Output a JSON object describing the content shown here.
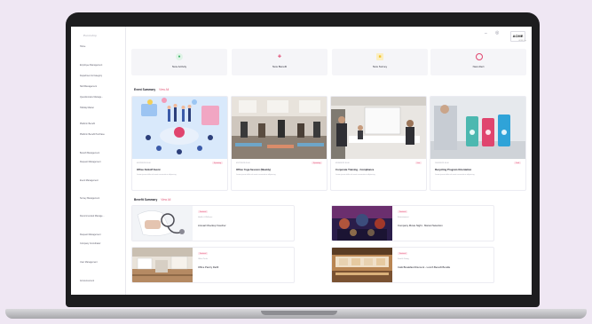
{
  "sidebar": {
    "brand": "Pointship",
    "items": [
      {
        "label": "Home",
        "top": 0
      },
      {
        "label": "Employee Management"
      },
      {
        "label": "Department & Category"
      },
      {
        "label": "Skill Management"
      },
      {
        "label": "Questionnaire Manage..."
      },
      {
        "label": "Holiday Master"
      },
      {
        "label": "Platform Benefit"
      },
      {
        "label": "Platform Benefit Purchase"
      },
      {
        "label": "Benefit Management"
      },
      {
        "label": "Request Management"
      },
      {
        "label": "Event Management"
      },
      {
        "label": "Survey Management"
      },
      {
        "label": "Recommended Manage..."
      },
      {
        "label": "Request Management"
      },
      {
        "label": "Company Coordinator"
      },
      {
        "label": "User Management"
      },
      {
        "label": "Announcement"
      }
    ]
  },
  "header": {
    "logo": "ACME",
    "logo_sub": "ACME Corp",
    "user_icon": "user-icon",
    "minimize_icon": "minus-icon"
  },
  "quick_actions": [
    {
      "label": "New Activity",
      "icon": "leaf-icon",
      "color": "#3fb36a"
    },
    {
      "label": "New Benefit",
      "icon": "gift-icon",
      "color": "#e0456e"
    },
    {
      "label": "New Survey",
      "icon": "star-icon",
      "color": "#f2c230"
    },
    {
      "label": "New Alert",
      "icon": "bell-icon",
      "color": "#e0456e"
    }
  ],
  "event_summary": {
    "title": "Event Summary",
    "link": "View All",
    "events": [
      {
        "date": "09/22/2023 09:00",
        "title": "Office Kickoff Event",
        "desc": "Lorem ipsum dolor sit amet consectetur adipiscing",
        "badge": "Upcoming"
      },
      {
        "date": "09/27/2023 09:00",
        "title": "Office Yoga Session (Weekly)",
        "desc": "Lorem ipsum dolor sit amet consectetur adipiscing",
        "badge": "Upcoming"
      },
      {
        "date": "09/30/2023 10:00",
        "title": "Corporate Training - Compliance",
        "desc": "Lorem ipsum dolor sit amet consectetur adipiscing",
        "badge": "Live"
      },
      {
        "date": "10/05/2023 10:00",
        "title": "Recycling Program Orientation",
        "desc": "Lorem ipsum dolor sit amet consectetur adipiscing",
        "badge": "Draft"
      }
    ]
  },
  "benefit_summary": {
    "title": "Benefit Summary",
    "link": "View All",
    "benefits": [
      {
        "badge": "Featured",
        "category": "Health & Wellness",
        "title": "Annual Checkup Voucher"
      },
      {
        "badge": "Featured",
        "category": "Entertainment",
        "title": "Company Movie Night - Marvel Selection"
      },
      {
        "badge": "Featured",
        "category": "Office Perks",
        "title": "Office Pantry Refill"
      },
      {
        "badge": "Featured",
        "category": "Food & Dining",
        "title": "Café Breakfast Discount - Lunch Benefit Bundle"
      }
    ]
  }
}
